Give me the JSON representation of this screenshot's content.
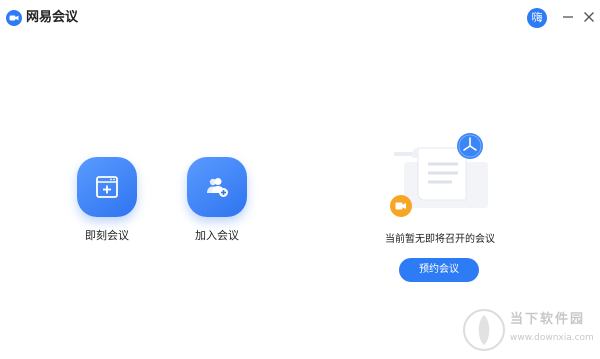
{
  "app": {
    "title": "网易会议",
    "logo_icon": "camera-icon",
    "brand_color": "#2e7bf6"
  },
  "titlebar": {
    "avatar_text": "嗨",
    "minimize_icon": "minimize-icon",
    "close_icon": "close-icon"
  },
  "actions": [
    {
      "label": "即刻会议",
      "icon": "new-meeting-window-icon"
    },
    {
      "label": "加入会议",
      "icon": "join-meeting-users-icon"
    }
  ],
  "empty_state": {
    "text": "当前暂无即将召开的会议",
    "schedule_button": "预约会议",
    "illustration": "empty-schedule-illustration"
  },
  "watermark": {
    "text": "当下软件园",
    "url": "www.downxia.com"
  }
}
